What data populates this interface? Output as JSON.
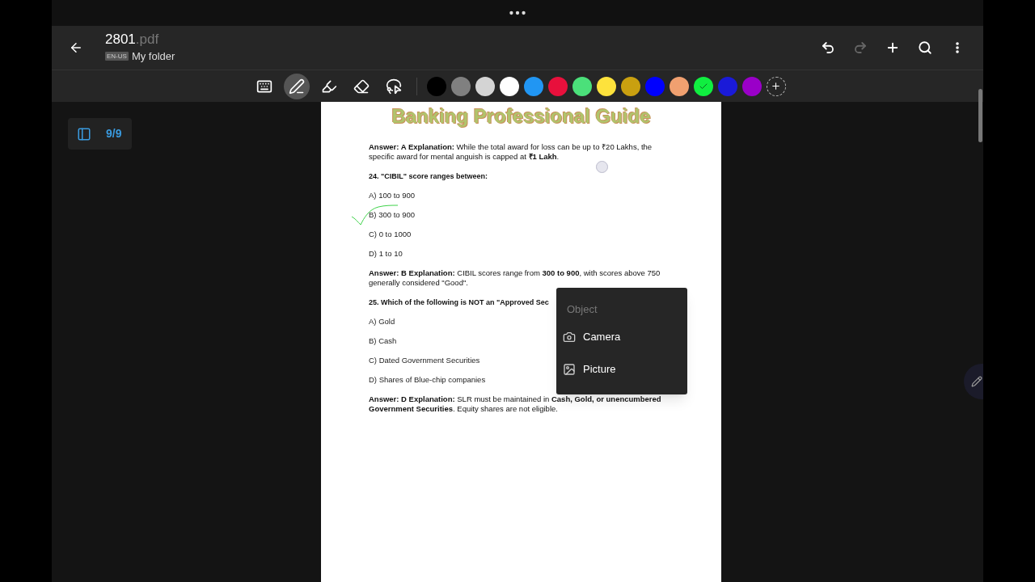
{
  "header": {
    "file_name": "2801",
    "file_ext": ".pdf",
    "language_badge": "EN-US",
    "folder": "My folder",
    "actions": [
      {
        "kind": "undo",
        "disabled": false
      },
      {
        "kind": "redo",
        "disabled": true
      },
      {
        "kind": "add",
        "disabled": false
      },
      {
        "kind": "search",
        "disabled": false
      },
      {
        "kind": "more",
        "disabled": false
      }
    ]
  },
  "tools": [
    {
      "kind": "keyboard",
      "selected": false
    },
    {
      "kind": "pen",
      "selected": true
    },
    {
      "kind": "highlighter",
      "selected": false
    },
    {
      "kind": "eraser",
      "selected": false
    },
    {
      "kind": "lasso",
      "selected": false
    }
  ],
  "colors": [
    {
      "color": "#000000",
      "selected": false
    },
    {
      "color": "#808080",
      "selected": false
    },
    {
      "color": "#d4d4d4",
      "selected": false
    },
    {
      "color": "#ffffff",
      "selected": false
    },
    {
      "color": "#2196f3",
      "selected": false
    },
    {
      "color": "#e8103c",
      "selected": false
    },
    {
      "color": "#4be07a",
      "selected": false
    },
    {
      "color": "#fde23c",
      "selected": false
    },
    {
      "color": "#c9a010",
      "selected": false
    },
    {
      "color": "#0000ff",
      "selected": false
    },
    {
      "color": "#f0a070",
      "selected": false
    },
    {
      "color": "#10ee40",
      "selected": true
    },
    {
      "color": "#1a1ad8",
      "selected": false
    },
    {
      "color": "#9a00c8",
      "selected": false
    }
  ],
  "page_indicator": "9/9",
  "document": {
    "title": "Banking Professional Guide",
    "blocks": [
      {
        "kind": "paragraph",
        "text": "**Answer: A Explanation:** While the total award for loss can be up to ₹20 Lakhs, the specific award for mental anguish is capped at **₹1 Lakh**."
      },
      {
        "kind": "question",
        "text": "24. \"CIBIL\" score ranges between:"
      },
      {
        "kind": "option",
        "text": "A) 100 to 900"
      },
      {
        "kind": "option",
        "text": "B) 300 to 900"
      },
      {
        "kind": "option",
        "text": "C) 0 to 1000"
      },
      {
        "kind": "option",
        "text": "D) 1 to 10"
      },
      {
        "kind": "paragraph",
        "text": "**Answer: B Explanation:** CIBIL scores range from **300 to 900**, with scores above 750 generally considered \"Good\"."
      },
      {
        "kind": "question",
        "text": "25. Which of the following is NOT an \"Approved Sec"
      },
      {
        "kind": "option",
        "text": "A) Gold"
      },
      {
        "kind": "option",
        "text": "B) Cash"
      },
      {
        "kind": "option",
        "text": "C) Dated Government Securities"
      },
      {
        "kind": "option",
        "text": "D) Shares of Blue-chip companies"
      },
      {
        "kind": "paragraph",
        "text": "**Answer: D Explanation:** SLR must be maintained in **Cash, Gold, or unencumbered Government Securities**. Equity shares are not eligible."
      }
    ]
  },
  "object_menu": {
    "title": "Object",
    "items": [
      {
        "kind": "camera",
        "label": "Camera"
      },
      {
        "kind": "picture",
        "label": "Picture"
      }
    ]
  }
}
